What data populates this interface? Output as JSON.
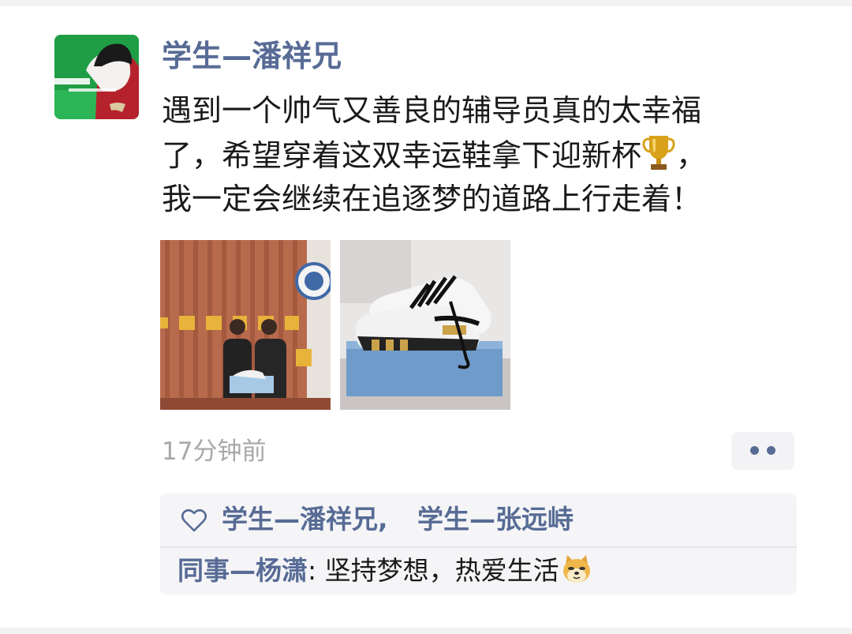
{
  "post": {
    "author": "学生—潘祥兄",
    "text_lines": [
      "遇到一个帅气又善良的辅导员真的太幸福",
      "了，希望穿着这双幸运鞋拿下迎新杯",
      "，",
      "我一定会继续在追逐梦的道路上行走着！"
    ],
    "trophy_icon": "trophy-emoji",
    "photos": [
      {
        "icon": "photo-two-people-holding-shoebox"
      },
      {
        "icon": "photo-sneakers-on-box"
      }
    ],
    "time": "17分钟前",
    "more_icon": "two-dots"
  },
  "likes": {
    "icon": "heart-outline-icon",
    "names": [
      "学生—潘祥兄,",
      "学生—张远峙"
    ]
  },
  "comments": [
    {
      "author": "同事—杨潇",
      "separator": ": ",
      "text": "坚持梦想，热爱生活",
      "emoji_icon": "doge-emoji"
    }
  ],
  "colors": {
    "link": "#576b95",
    "text": "#1a1a1a",
    "muted": "#a8a8a8",
    "panel": "#f5f5f7"
  }
}
